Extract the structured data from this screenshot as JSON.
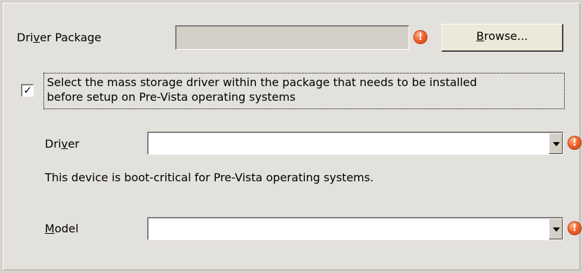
{
  "driver_package": {
    "label_pre": "Dri",
    "label_ul": "v",
    "label_post": "er Package",
    "value": "",
    "error_glyph": "!",
    "browse_ul": "B",
    "browse_rest": "rowse..."
  },
  "mass_storage": {
    "checked": true,
    "check_glyph": "✓",
    "line1": "Select the mass storage driver within the package that needs to be installed",
    "line2": "before setup on Pre-Vista operating systems"
  },
  "driver": {
    "label_pre": "Dri",
    "label_ul": "v",
    "label_post": "er",
    "selected": "",
    "error_glyph": "!"
  },
  "boot_note": "This device is boot-critical for Pre-Vista operating systems.",
  "model": {
    "label_ul": "M",
    "label_post": "odel",
    "selected": "",
    "error_glyph": "!"
  },
  "icons": {
    "error": "error-icon",
    "dropdown": "chevron-down-icon",
    "check": "checkmark-icon"
  },
  "colors": {
    "background": "#e3e1db",
    "error_icon": "#f0632a"
  }
}
